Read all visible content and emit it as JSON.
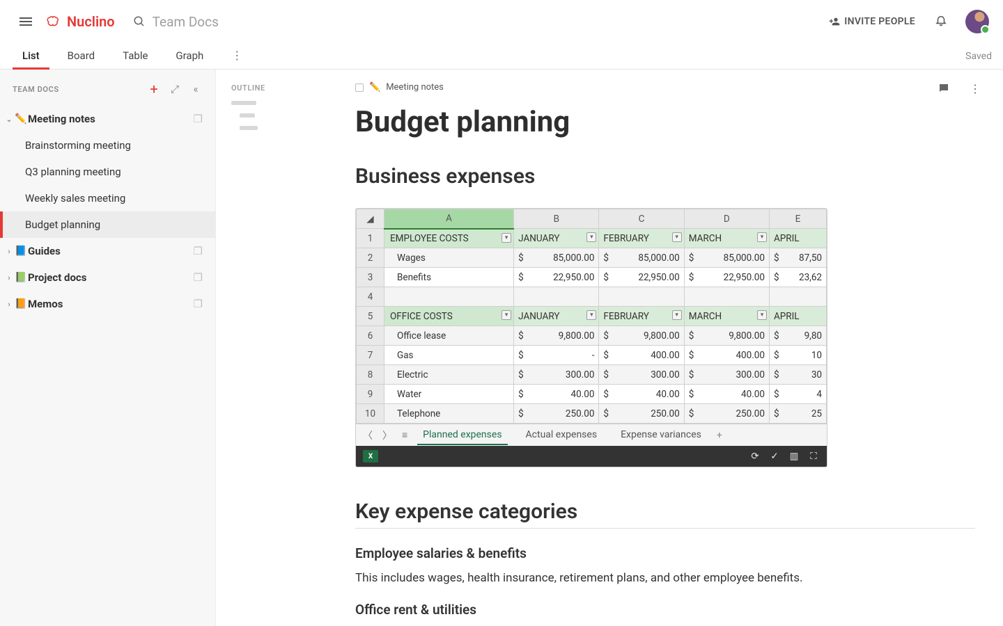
{
  "app": {
    "name": "Nuclino",
    "workspace": "Team Docs"
  },
  "header": {
    "invite": "INVITE PEOPLE",
    "tabs": [
      "List",
      "Board",
      "Table",
      "Graph"
    ],
    "active_tab": "List",
    "saved": "Saved"
  },
  "sidebar": {
    "title": "TEAM DOCS",
    "tree": [
      {
        "emoji": "✏️",
        "label": "Meeting notes",
        "expanded": true,
        "children": [
          "Brainstorming meeting",
          "Q3 planning meeting",
          "Weekly sales meeting",
          "Budget planning"
        ],
        "selected_child": "Budget planning"
      },
      {
        "emoji": "📘",
        "label": "Guides",
        "expanded": false
      },
      {
        "emoji": "📗",
        "label": "Project docs",
        "expanded": false
      },
      {
        "emoji": "📙",
        "label": "Memos",
        "expanded": false
      }
    ]
  },
  "outline": {
    "title": "OUTLINE"
  },
  "doc": {
    "breadcrumb": {
      "emoji": "✏️",
      "label": "Meeting notes"
    },
    "title": "Budget planning",
    "section1": "Business expenses",
    "section2": "Key expense categories",
    "sub1": "Employee salaries & benefits",
    "body1": "This includes wages, health insurance, retirement plans, and other employee benefits.",
    "sub2": "Office rent & utilities"
  },
  "sheet": {
    "columns": [
      "A",
      "B",
      "C",
      "D",
      "E"
    ],
    "selected_col": "A",
    "month_cols": [
      "JANUARY",
      "FEBRUARY",
      "MARCH",
      "APRIL"
    ],
    "sections": [
      {
        "row": 1,
        "title": "EMPLOYEE COSTS",
        "items": [
          {
            "row": 2,
            "name": "Wages",
            "vals": [
              "85,000.00",
              "85,000.00",
              "85,000.00",
              "87,50"
            ]
          },
          {
            "row": 3,
            "name": "Benefits",
            "vals": [
              "22,950.00",
              "22,950.00",
              "22,950.00",
              "23,62"
            ]
          }
        ]
      },
      {
        "row": 5,
        "title": "OFFICE COSTS",
        "items": [
          {
            "row": 6,
            "name": "Office lease",
            "vals": [
              "9,800.00",
              "9,800.00",
              "9,800.00",
              "9,80"
            ]
          },
          {
            "row": 7,
            "name": "Gas",
            "vals": [
              "-",
              "400.00",
              "400.00",
              "10"
            ]
          },
          {
            "row": 8,
            "name": "Electric",
            "vals": [
              "300.00",
              "300.00",
              "300.00",
              "30"
            ]
          },
          {
            "row": 9,
            "name": "Water",
            "vals": [
              "40.00",
              "40.00",
              "40.00",
              "4"
            ]
          },
          {
            "row": 10,
            "name": "Telephone",
            "vals": [
              "250.00",
              "250.00",
              "250.00",
              "25"
            ]
          }
        ]
      }
    ],
    "blank_row": 4,
    "tabs": [
      "Planned expenses",
      "Actual expenses",
      "Expense variances"
    ],
    "active_tab": "Planned expenses"
  }
}
